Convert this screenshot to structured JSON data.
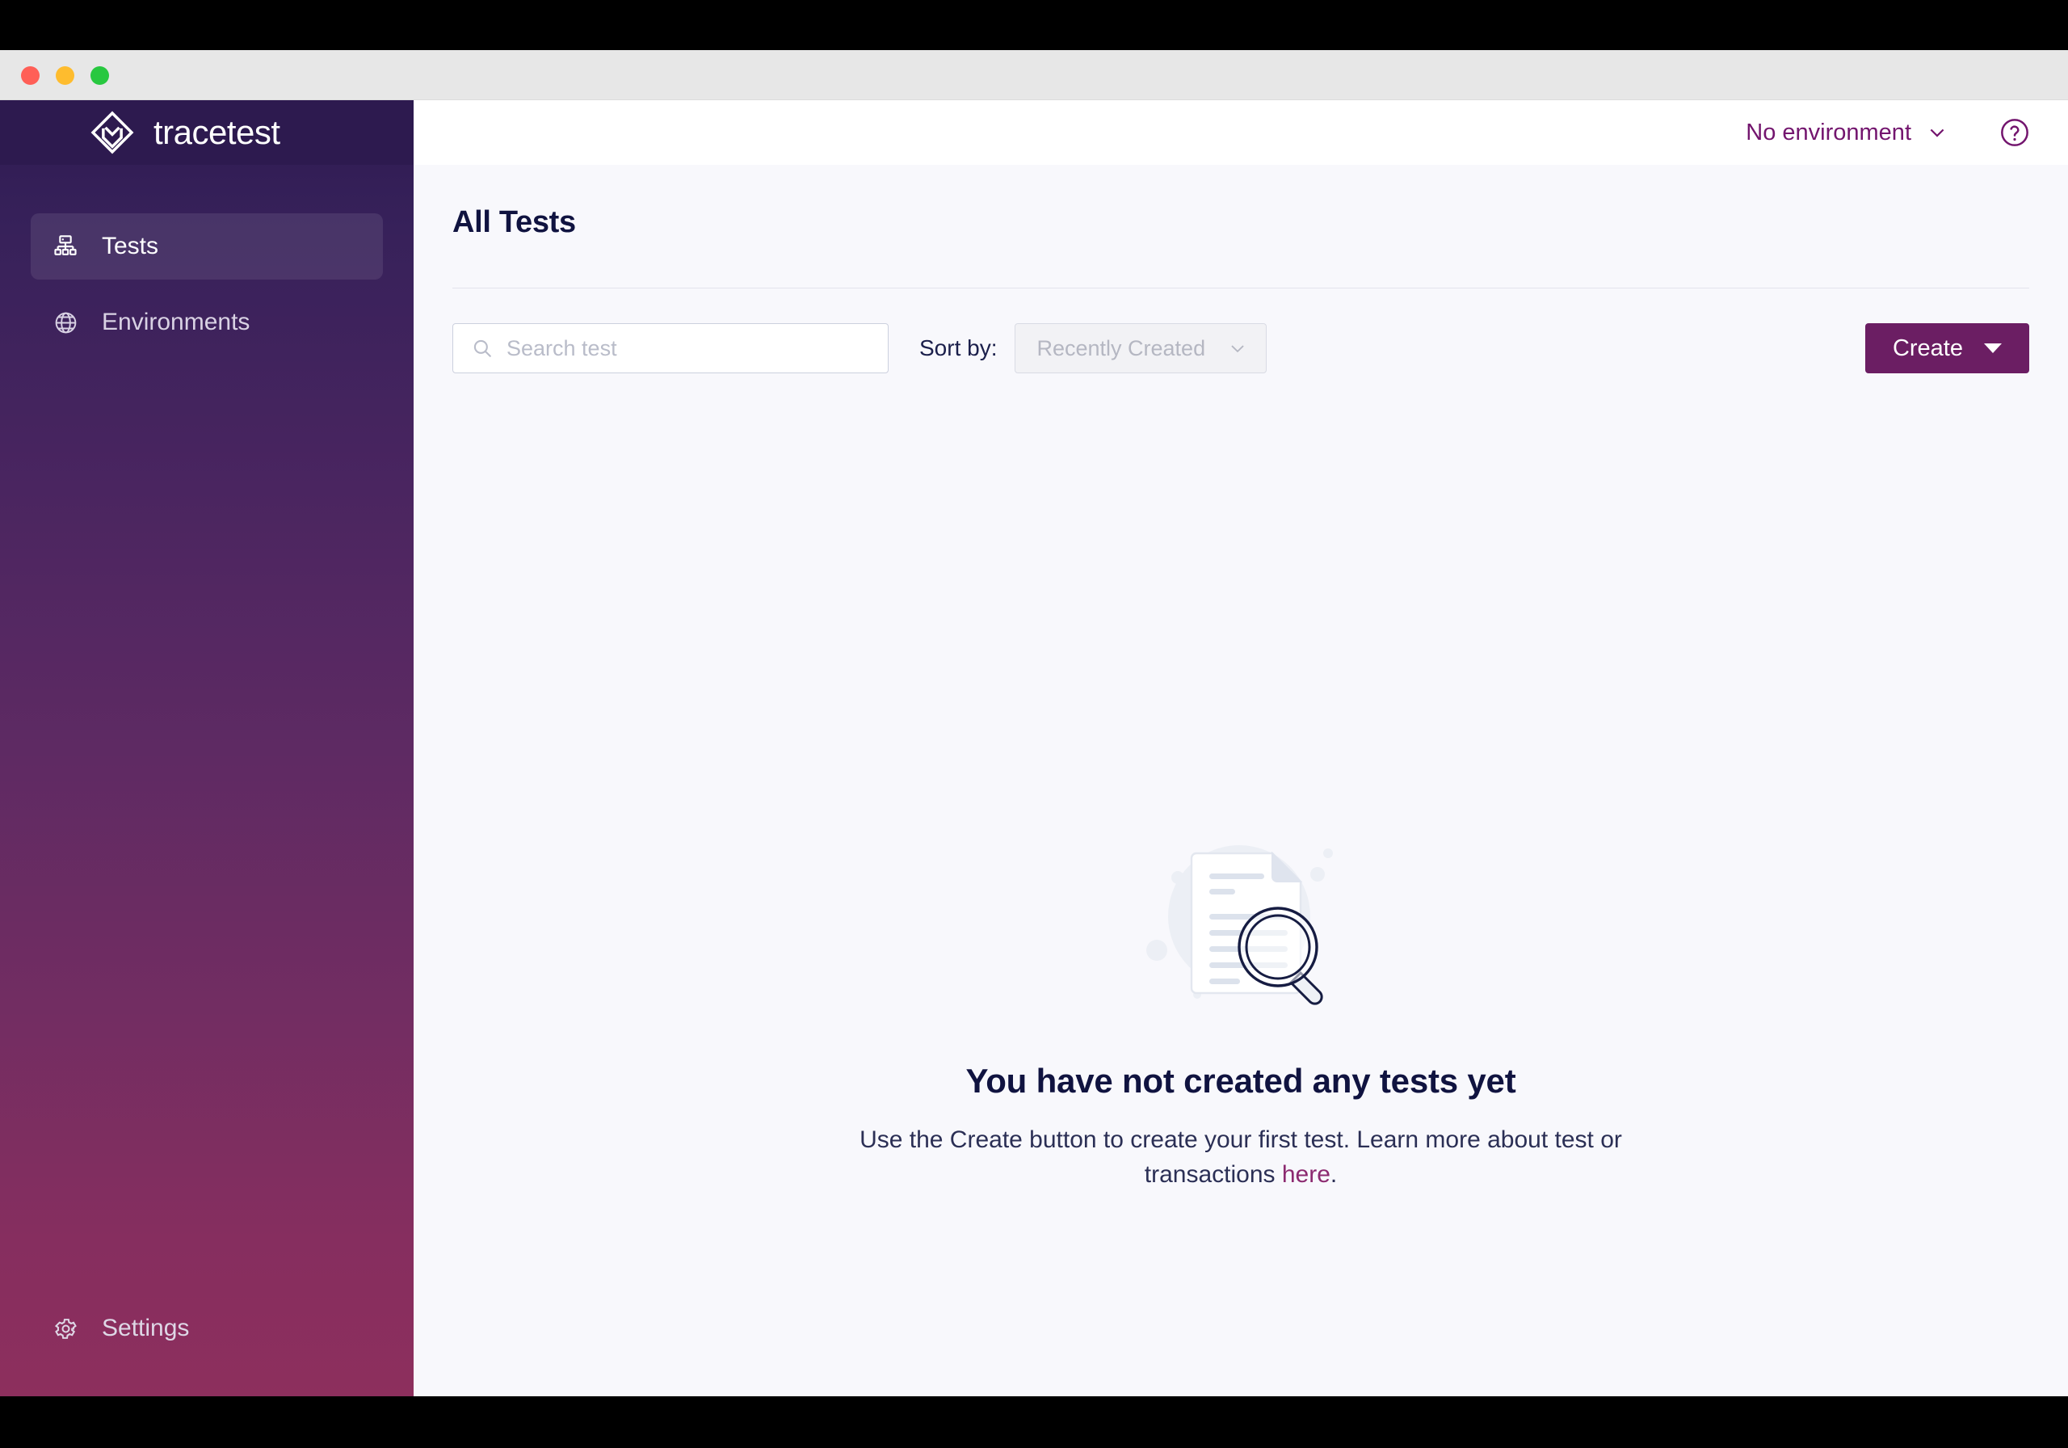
{
  "window": {
    "traffic_lights": [
      "close",
      "minimize",
      "maximize"
    ]
  },
  "sidebar": {
    "brand": "tracetest",
    "items": [
      {
        "label": "Tests",
        "icon": "sitemap-icon",
        "active": true
      },
      {
        "label": "Environments",
        "icon": "globe-icon",
        "active": false
      }
    ],
    "footer": {
      "label": "Settings",
      "icon": "gear-icon"
    }
  },
  "topbar": {
    "environment_label": "No environment",
    "environment_chevron": "chevron-down-icon",
    "help_icon": "question-circle-icon"
  },
  "main": {
    "page_title": "All Tests",
    "search": {
      "placeholder": "Search test",
      "value": "",
      "icon": "search-icon"
    },
    "sort": {
      "label": "Sort by:",
      "selected": "Recently Created",
      "chevron": "chevron-down-icon"
    },
    "create": {
      "label": "Create",
      "caret": "caret-down-icon"
    }
  },
  "empty_state": {
    "illustration": "document-magnifier-illustration",
    "title": "You have not created any tests yet",
    "description_part_1": "Use the Create button to create your first test. Learn more about test or transactions ",
    "link_text": "here",
    "description_part_2": "."
  },
  "colors": {
    "brand_purple": "#6b1e63",
    "accent_link": "#8c2a70",
    "sidebar_top": "#2e1b52",
    "sidebar_bottom": "#8d2f5d",
    "page_bg": "#f8f8fc",
    "heading": "#101340"
  }
}
